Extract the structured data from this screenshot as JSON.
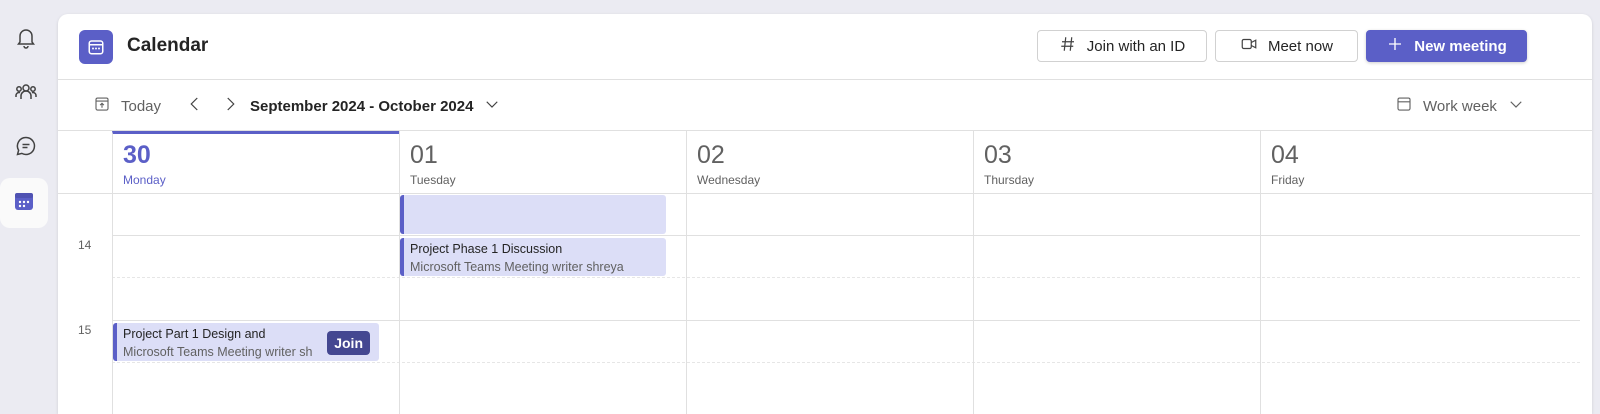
{
  "rail": {
    "items": [
      {
        "name": "activity",
        "icon": "bell-icon"
      },
      {
        "name": "teams",
        "icon": "people-icon"
      },
      {
        "name": "chat",
        "icon": "chat-icon"
      },
      {
        "name": "calendar",
        "icon": "calendar-icon",
        "active": true
      }
    ]
  },
  "header": {
    "title": "Calendar",
    "join_id_label": "Join with an ID",
    "meet_now_label": "Meet now",
    "new_meeting_label": "New meeting"
  },
  "toolbar": {
    "today_label": "Today",
    "range_label": "September 2024 - October 2024",
    "view_label": "Work week"
  },
  "days": [
    {
      "num": "30",
      "name": "Monday",
      "today": true
    },
    {
      "num": "01",
      "name": "Tuesday"
    },
    {
      "num": "02",
      "name": "Wednesday"
    },
    {
      "num": "03",
      "name": "Thursday"
    },
    {
      "num": "04",
      "name": "Friday"
    }
  ],
  "hours": [
    "14",
    "15"
  ],
  "events": [
    {
      "title": "",
      "subtitle": ""
    },
    {
      "title": "Project Phase 1 Discussion",
      "subtitle": "Microsoft Teams Meeting  writer shreya"
    },
    {
      "title": "Project Part 1 Design and",
      "subtitle": "Microsoft Teams Meeting  writer sh",
      "join_label": "Join"
    }
  ],
  "colors": {
    "accent": "#5b5fc7",
    "event_bg": "#dcdef7",
    "join_bg": "#444791"
  }
}
